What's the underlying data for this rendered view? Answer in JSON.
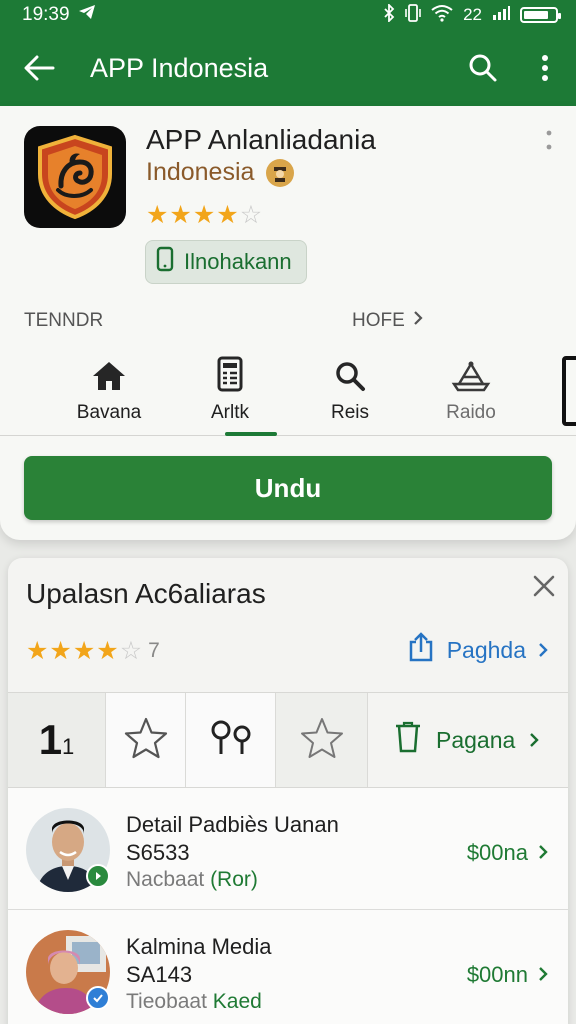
{
  "status_bar": {
    "time": "19:39",
    "signal_text": "22",
    "battery_level": 0.8
  },
  "app_bar": {
    "title": "APP Indonesia"
  },
  "app_card": {
    "name": "APP Anlanliadania",
    "publisher": "Indonesia",
    "rating": 4,
    "rating_max": 5,
    "install_label": "Ilnohakann",
    "trend_label": "TENNDR",
    "more_label": "HOFE",
    "download_label": "Undu"
  },
  "tabs": [
    {
      "label": "Bavana",
      "icon": "home-icon"
    },
    {
      "label": "Arltk",
      "icon": "document-icon"
    },
    {
      "label": "Reis",
      "icon": "search-icon"
    },
    {
      "label": "Raido",
      "icon": "radio-icon"
    }
  ],
  "active_tab": 1,
  "reviews": {
    "title": "Upalasn Ac6aliaras",
    "rating": 4,
    "rating_count": "7",
    "help_label": "Paghda",
    "filter_number": "1",
    "filter_number_small": "1",
    "filter_link_label": "Pagana",
    "items": [
      {
        "name": "Detail Padbiès Uanan",
        "code": "S6533",
        "sub_prefix": "Nacbaat",
        "sub_accent": "(Ror)",
        "price": "$00na",
        "badge_color": "#2a8a3e"
      },
      {
        "name": "Kalmina Media",
        "code": "SA143",
        "sub_prefix": "Tieobaat",
        "sub_accent": "Kaed",
        "price": "$00nn",
        "badge_color": "#2f7fd6"
      }
    ]
  },
  "colors": {
    "primary": "#1d7a36",
    "accent_blue": "#2673c3",
    "star": "#f2a51a"
  }
}
